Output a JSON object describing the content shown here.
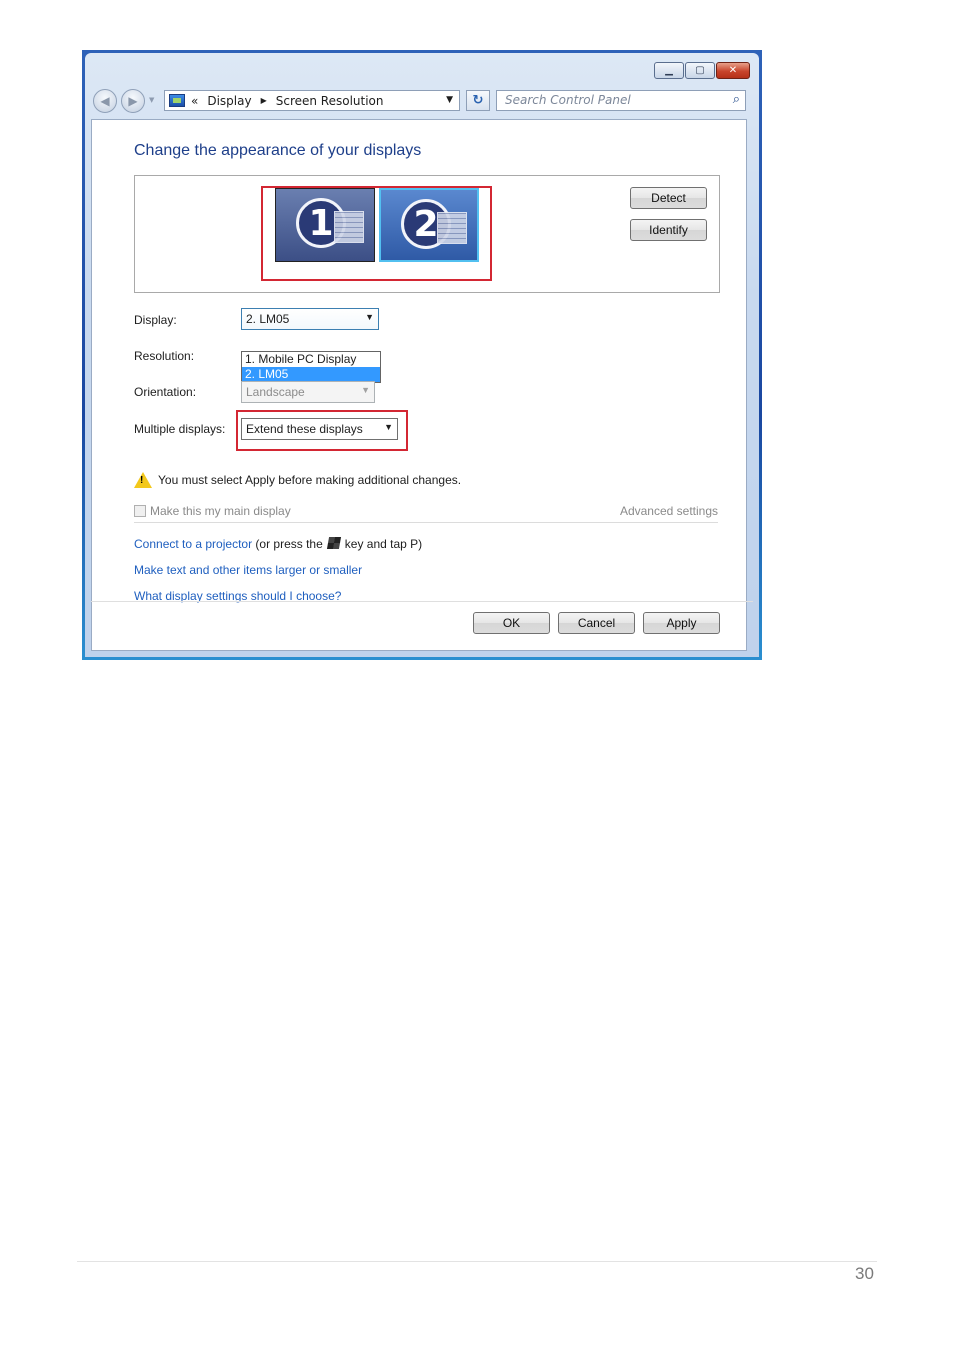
{
  "window": {
    "caption_buttons": {
      "minimize_icon": "minimize-icon",
      "maximize_icon": "maximize-icon",
      "close_icon": "close-icon"
    },
    "breadcrumb": {
      "overflow": "«",
      "items": [
        "Display",
        "Screen Resolution"
      ]
    },
    "search": {
      "placeholder": "Search Control Panel"
    }
  },
  "main": {
    "heading": "Change the appearance of your displays",
    "monitors": [
      {
        "number": "1",
        "active": false
      },
      {
        "number": "2",
        "active": true
      }
    ],
    "detect_label": "Detect",
    "identify_label": "Identify",
    "display": {
      "label": "Display:",
      "value": "2. LM05",
      "options": [
        "1. Mobile PC Display",
        "2. LM05"
      ],
      "selected_index": 1
    },
    "resolution": {
      "label": "Resolution:"
    },
    "orientation": {
      "label": "Orientation:",
      "value": "Landscape"
    },
    "multiple_displays": {
      "label": "Multiple displays:",
      "value": "Extend these displays"
    },
    "warning": "You must select Apply before making additional changes.",
    "main_display_checkbox": {
      "label": "Make this my main display",
      "checked": false
    },
    "advanced_settings": "Advanced settings",
    "links": {
      "projector": "Connect to a projector",
      "projector_suffix_pre": "(or press the",
      "projector_suffix_post": "key and tap P)",
      "text_size": "Make text and other items larger or smaller",
      "help": "What display settings should I choose?"
    },
    "buttons": {
      "ok": "OK",
      "cancel": "Cancel",
      "apply": "Apply"
    }
  },
  "page": {
    "number": "30"
  },
  "colors": {
    "highlight_box": "#d32733",
    "link": "#1f5fbf",
    "heading": "#1e3f8a",
    "selected": "#3399ff"
  }
}
